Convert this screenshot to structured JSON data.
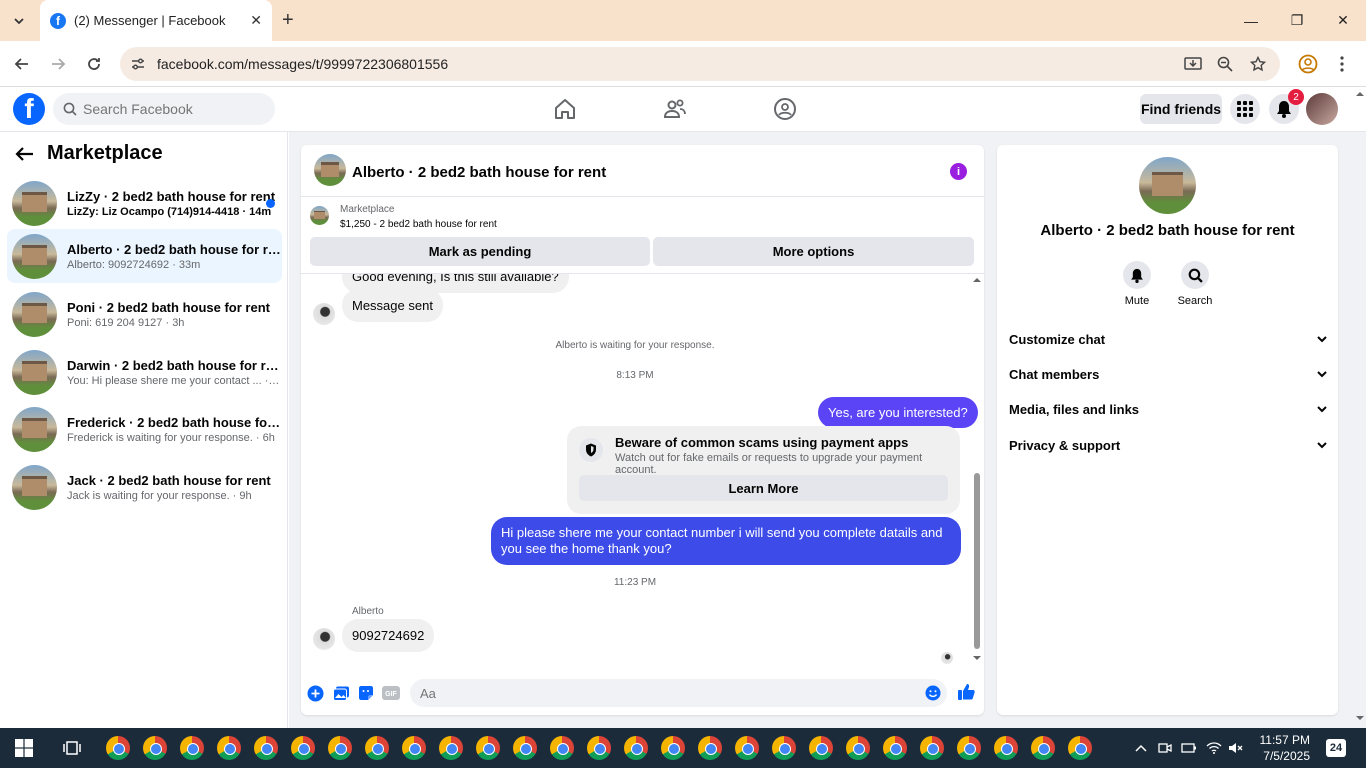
{
  "browser": {
    "tab_title": "(2) Messenger | Facebook",
    "url": "facebook.com/messages/t/9999722306801556"
  },
  "fb_header": {
    "search_placeholder": "Search Facebook",
    "find_friends": "Find friends",
    "notification_count": "2"
  },
  "sidebar": {
    "title": "Marketplace",
    "conversations": [
      {
        "name": "LizZy · 2 bed2 bath house for rent",
        "last": "LizZy: Liz Ocampo (714)914-4418 · 14m",
        "unread": true
      },
      {
        "name": "Alberto · 2 bed2 bath house for rent",
        "last": "Alberto: 9092724692 · 33m",
        "selected": true
      },
      {
        "name": "Poni · 2 bed2 bath house for rent",
        "last": "Poni: 619 204 9127 · 3h"
      },
      {
        "name": "Darwin · 2 bed2 bath house for rent",
        "last": "You: Hi please shere me your contact ... · 3h"
      },
      {
        "name": "Frederick · 2 bed2 bath house for r...",
        "last": "Frederick is waiting for your response. · 6h"
      },
      {
        "name": "Jack · 2 bed2 bath house for rent",
        "last": "Jack is waiting for your response. · 9h"
      }
    ]
  },
  "chat": {
    "title": "Alberto · 2 bed2 bath house for rent",
    "listing_label": "Marketplace",
    "listing_price": "$1,250 - 2 bed2 bath house for rent",
    "mark_pending": "Mark as pending",
    "more_options": "More options",
    "messages": {
      "partial_top": "Good evening, Is this still available?",
      "message_sent": "Message sent",
      "waiting": "Alberto is waiting for your response.",
      "time1": "8:13 PM",
      "out1": "Yes, are you interested?",
      "scam_title": "Beware of common scams using payment apps",
      "scam_body": "Watch out for fake emails or requests to upgrade your payment account.",
      "learn_more": "Learn More",
      "out2": "Hi please shere me your contact number i will send you complete datails and you see the home thank you?",
      "time2": "11:23 PM",
      "sender": "Alberto",
      "in_last": "9092724692"
    },
    "composer_placeholder": "Aa"
  },
  "info_panel": {
    "name": "Alberto · 2 bed2 bath house for rent",
    "mute": "Mute",
    "search": "Search",
    "sections": [
      "Customize chat",
      "Chat members",
      "Media, files and links",
      "Privacy & support"
    ]
  },
  "taskbar": {
    "time": "11:57 PM",
    "date": "7/5/2025",
    "notifications": "24"
  },
  "colors": {
    "fb_blue": "#0866ff",
    "outgoing_bubble": "#5b44f6",
    "info_purple": "#9a1ee0",
    "tab_strip": "#f9e2cc"
  }
}
